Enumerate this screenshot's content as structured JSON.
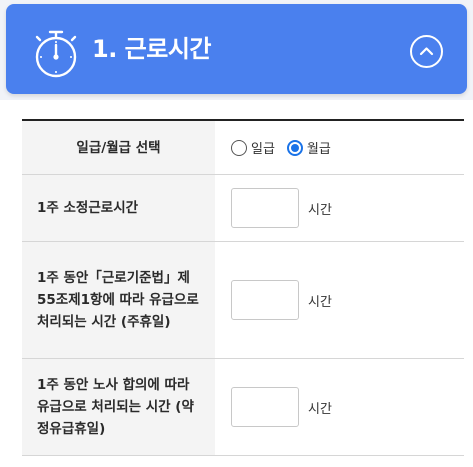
{
  "header": {
    "title": "1. 근로시간",
    "icon": "stopwatch-icon",
    "collapse_icon": "chevron-up-icon",
    "color": "#4a80ee"
  },
  "form": {
    "pay_type": {
      "label": "일급/월급 선택",
      "options": [
        "일급",
        "월급"
      ],
      "selected": "월급"
    },
    "weekly_hours": {
      "label": "1주 소정근로시간",
      "value": "",
      "unit": "시간"
    },
    "paid_hours_law": {
      "label": "1주 동안「근로기준법」제55조제1항에 따라 유급으로 처리되는 시간 (주휴일)",
      "value": "",
      "unit": "시간"
    },
    "paid_hours_agreement": {
      "label": "1주 동안 노사 합의에 따라 유급으로 처리되는 시간 (약정유급휴일)",
      "value": "",
      "unit": "시간"
    }
  }
}
